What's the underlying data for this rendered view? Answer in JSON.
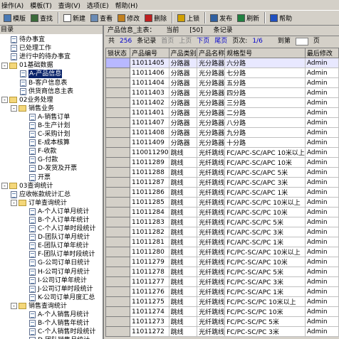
{
  "menu": [
    "操作(A)",
    "模板(T)",
    "查询(V)",
    "选项(E)",
    "帮助(H)"
  ],
  "toolbar": [
    {
      "label": "模版",
      "icon": "template-icon",
      "color": "#4a7ab5"
    },
    {
      "label": "查找",
      "icon": "search-icon",
      "color": "#3a6a3a"
    },
    {
      "label": "新建",
      "icon": "new-icon",
      "color": "#ffffff"
    },
    {
      "label": "查看",
      "icon": "view-icon",
      "color": "#6a8bb5"
    },
    {
      "label": "修改",
      "icon": "edit-icon",
      "color": "#c08020"
    },
    {
      "label": "删除",
      "icon": "delete-icon",
      "color": "#c02020"
    },
    {
      "label": "上锁",
      "icon": "lock-icon",
      "color": "#d0a000"
    },
    {
      "label": "发布",
      "icon": "publish-icon",
      "color": "#3060a0"
    },
    {
      "label": "刷新",
      "icon": "refresh-icon",
      "color": "#208040"
    },
    {
      "label": "帮助",
      "icon": "help-icon",
      "color": "#2050c0"
    }
  ],
  "left": {
    "title": "目录",
    "tree": [
      {
        "level": 1,
        "type": "doc",
        "label": "待办事宜"
      },
      {
        "level": 1,
        "type": "doc",
        "label": "已处理工作"
      },
      {
        "level": 1,
        "type": "doc",
        "label": "进行中的待办事宜"
      },
      {
        "level": 0,
        "type": "folder",
        "label": "01基础数据",
        "box": "-"
      },
      {
        "level": 2,
        "type": "doc",
        "label": "A-产品信息",
        "selected": true
      },
      {
        "level": 2,
        "type": "doc",
        "label": "B-客户信息表"
      },
      {
        "level": 2,
        "type": "doc",
        "label": "供货商信息主表"
      },
      {
        "level": 0,
        "type": "folder",
        "label": "02业务处理",
        "box": "-"
      },
      {
        "level": 1,
        "type": "folder",
        "label": "销售业务",
        "box": "-"
      },
      {
        "level": 3,
        "type": "doc",
        "label": "A-销售订单"
      },
      {
        "level": 3,
        "type": "doc",
        "label": "B-生产计划"
      },
      {
        "level": 3,
        "type": "doc",
        "label": "C-采购计划"
      },
      {
        "level": 3,
        "type": "doc",
        "label": "E-成本核算"
      },
      {
        "level": 3,
        "type": "doc",
        "label": "F-收款"
      },
      {
        "level": 3,
        "type": "doc",
        "label": "G-付款"
      },
      {
        "level": 3,
        "type": "doc",
        "label": "D-发货及开票"
      },
      {
        "level": 3,
        "type": "doc",
        "label": "开票"
      },
      {
        "level": 0,
        "type": "folder",
        "label": "03查询统计",
        "box": "-"
      },
      {
        "level": 1,
        "type": "doc",
        "label": "应收帐款统计汇总"
      },
      {
        "level": 1,
        "type": "folder",
        "label": "订单查询统计",
        "box": "-"
      },
      {
        "level": 3,
        "type": "doc",
        "label": "A-个人订单月统计"
      },
      {
        "level": 3,
        "type": "doc",
        "label": "B-个人订单年统计"
      },
      {
        "level": 3,
        "type": "doc",
        "label": "C-个人订单时段统计"
      },
      {
        "level": 3,
        "type": "doc",
        "label": "D-团队订单月统计"
      },
      {
        "level": 3,
        "type": "doc",
        "label": "E-团队订单年统计"
      },
      {
        "level": 3,
        "type": "doc",
        "label": "F-团队订单时段统计"
      },
      {
        "level": 3,
        "type": "doc",
        "label": "G-公司订单日统计"
      },
      {
        "level": 3,
        "type": "doc",
        "label": "H-公司订单月统计"
      },
      {
        "level": 3,
        "type": "doc",
        "label": "I-公司订单年统计"
      },
      {
        "level": 3,
        "type": "doc",
        "label": "J-公司订单时段统计"
      },
      {
        "level": 3,
        "type": "doc",
        "label": "K-公司订单月度汇总"
      },
      {
        "level": 1,
        "type": "folder",
        "label": "销售查询统计",
        "box": "-"
      },
      {
        "level": 3,
        "type": "doc",
        "label": "A-个人销售月统计"
      },
      {
        "level": 3,
        "type": "doc",
        "label": "B-个人销售年统计"
      },
      {
        "level": 3,
        "type": "doc",
        "label": "C-个人销售时段统计"
      },
      {
        "level": 3,
        "type": "doc",
        "label": "D-团队销售月统计"
      }
    ]
  },
  "right": {
    "caption_title": "产品信息_主表：",
    "caption_current": "当前",
    "caption_view": "[50]",
    "caption_records": "条记录",
    "nav": {
      "total_label": "共",
      "total": "256",
      "records_label": "条记录",
      "first": "首页",
      "prev": "上页",
      "next": "下页",
      "last": "尾页",
      "page_label": "页次:",
      "page": "1/6",
      "goto_label": "到第",
      "goto_suffix": "页"
    },
    "columns": [
      "锁状态",
      "产品编号",
      "产品类别",
      "产品名称",
      "规格型号",
      "最后修改"
    ],
    "rows": [
      [
        "",
        "11011405",
        "分路器",
        "光分路器",
        "六分路",
        "Admin"
      ],
      [
        "",
        "11011406",
        "分路器",
        "光分路器",
        "七分路",
        "Admin"
      ],
      [
        "",
        "11011404",
        "分路器",
        "光分路器",
        "五分路",
        "Admin"
      ],
      [
        "",
        "11011403",
        "分路器",
        "光分路器",
        "四分路",
        "Admin"
      ],
      [
        "",
        "11011402",
        "分路器",
        "光分路器",
        "三分路",
        "Admin"
      ],
      [
        "",
        "11011401",
        "分路器",
        "光分路器",
        "二分路",
        "Admin"
      ],
      [
        "",
        "11011407",
        "分路器",
        "光分路器",
        "八分路",
        "Admin"
      ],
      [
        "",
        "11011408",
        "分路器",
        "光分路器",
        "九分路",
        "Admin"
      ],
      [
        "",
        "11011409",
        "分路器",
        "光分路器",
        "十分路",
        "Admin"
      ],
      [
        "",
        "110011290",
        "跳线",
        "光纤跳线",
        "FC/APC-SC/APC 10米以上",
        "Admin"
      ],
      [
        "",
        "11011289",
        "跳线",
        "光纤跳线",
        "FC/APC-SC/APC 10米",
        "Admin"
      ],
      [
        "",
        "11011288",
        "跳线",
        "光纤跳线",
        "FC/APC-SC/APC 5米",
        "Admin"
      ],
      [
        "",
        "11011287",
        "跳线",
        "光纤跳线",
        "FC/APC-SC/APC 3米",
        "Admin"
      ],
      [
        "",
        "11011286",
        "跳线",
        "光纤跳线",
        "FC/APC-SC/APC 1米",
        "Admin"
      ],
      [
        "",
        "11011285",
        "跳线",
        "光纤跳线",
        "FC/APC-SC/PC 10米以上",
        "Admin"
      ],
      [
        "",
        "11011284",
        "跳线",
        "光纤跳线",
        "FC/APC-SC/PC 10米",
        "Admin"
      ],
      [
        "",
        "11011283",
        "跳线",
        "光纤跳线",
        "FC/APC-SC/PC 5米",
        "Admin"
      ],
      [
        "",
        "11011282",
        "跳线",
        "光纤跳线",
        "FC/APC-SC/PC 3米",
        "Admin"
      ],
      [
        "",
        "11011281",
        "跳线",
        "光纤跳线",
        "FC/APC-SC/PC 1米",
        "Admin"
      ],
      [
        "",
        "11011280",
        "跳线",
        "光纤跳线",
        "FC/PC-SC/APC 10米以上",
        "Admin"
      ],
      [
        "",
        "11011279",
        "跳线",
        "光纤跳线",
        "FC/PC-SC/APC 10米",
        "Admin"
      ],
      [
        "",
        "11011278",
        "跳线",
        "光纤跳线",
        "FC/PC-SC/APC 5米",
        "Admin"
      ],
      [
        "",
        "11011277",
        "跳线",
        "光纤跳线",
        "FC/PC-SC/APC 3米",
        "Admin"
      ],
      [
        "",
        "11011276",
        "跳线",
        "光纤跳线",
        "FC/PC-SC/APC 1米",
        "Admin"
      ],
      [
        "",
        "11011275",
        "跳线",
        "光纤跳线",
        "FC/PC-SC/PC 10米以上",
        "Admin"
      ],
      [
        "",
        "11011274",
        "跳线",
        "光纤跳线",
        "FC/PC-SC/PC 10米",
        "Admin"
      ],
      [
        "",
        "11011273",
        "跳线",
        "光纤跳线",
        "FC/PC-SC/PC 5米",
        "Admin"
      ],
      [
        "",
        "11011272",
        "跳线",
        "光纤跳线",
        "FC/PC-SC/PC 3米",
        "Admin"
      ]
    ]
  }
}
